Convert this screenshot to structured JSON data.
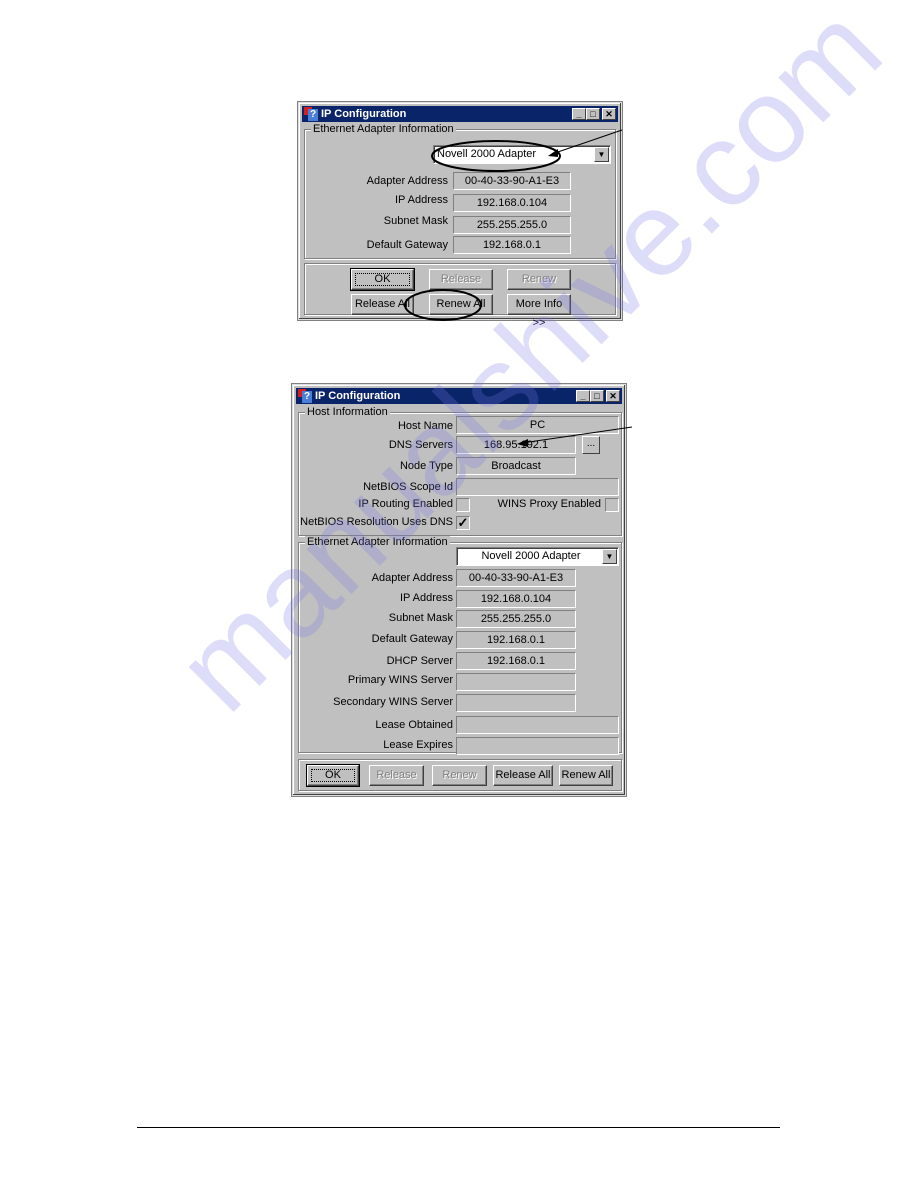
{
  "watermark": "manualshive.com",
  "dialog1": {
    "title": "IP Configuration",
    "window_buttons": {
      "minimize": "_",
      "maximize": "□",
      "close": "✕"
    },
    "adapter_group": {
      "label": "Ethernet  Adapter Information",
      "adapter_select": "Novell 2000 Adapter",
      "fields": [
        {
          "label": "Adapter Address",
          "value": "00-40-33-90-A1-E3"
        },
        {
          "label": "IP Address",
          "value": "192.168.0.104"
        },
        {
          "label": "Subnet Mask",
          "value": "255.255.255.0"
        },
        {
          "label": "Default Gateway",
          "value": "192.168.0.1"
        }
      ]
    },
    "buttons": {
      "ok": "OK",
      "release": "Release",
      "renew": "Renew",
      "release_all": "Release All",
      "renew_all": "Renew All",
      "more_info": "More Info >>"
    }
  },
  "dialog2": {
    "title": "IP Configuration",
    "window_buttons": {
      "minimize": "_",
      "maximize": "□",
      "close": "✕"
    },
    "host_group": {
      "label": "Host Information",
      "host_name_label": "Host Name",
      "host_name": "PC",
      "dns_label": "DNS Servers",
      "dns": "168.95.192.1",
      "dns_more": "...",
      "node_type_label": "Node Type",
      "node_type": "Broadcast",
      "scope_id_label": "NetBIOS Scope Id",
      "scope_id": "",
      "ip_routing_label": "IP Routing Enabled",
      "ip_routing": false,
      "wins_proxy_label": "WINS Proxy Enabled",
      "wins_proxy": false,
      "netbios_dns_label": "NetBIOS Resolution Uses DNS",
      "netbios_dns": true,
      "check_mark": "✓"
    },
    "adapter_group": {
      "label": "Ethernet  Adapter Information",
      "adapter_select": "Novell 2000 Adapter",
      "fields": [
        {
          "label": "Adapter Address",
          "value": "00-40-33-90-A1-E3"
        },
        {
          "label": "IP Address",
          "value": "192.168.0.104"
        },
        {
          "label": "Subnet Mask",
          "value": "255.255.255.0"
        },
        {
          "label": "Default Gateway",
          "value": "192.168.0.1"
        },
        {
          "label": "DHCP Server",
          "value": "192.168.0.1"
        },
        {
          "label": "Primary WINS Server",
          "value": ""
        },
        {
          "label": "Secondary WINS Server",
          "value": ""
        },
        {
          "label": "Lease Obtained",
          "value": ""
        },
        {
          "label": "Lease Expires",
          "value": ""
        }
      ]
    },
    "buttons": {
      "ok": "OK",
      "release": "Release",
      "renew": "Renew",
      "release_all": "Release All",
      "renew_all": "Renew All"
    }
  }
}
